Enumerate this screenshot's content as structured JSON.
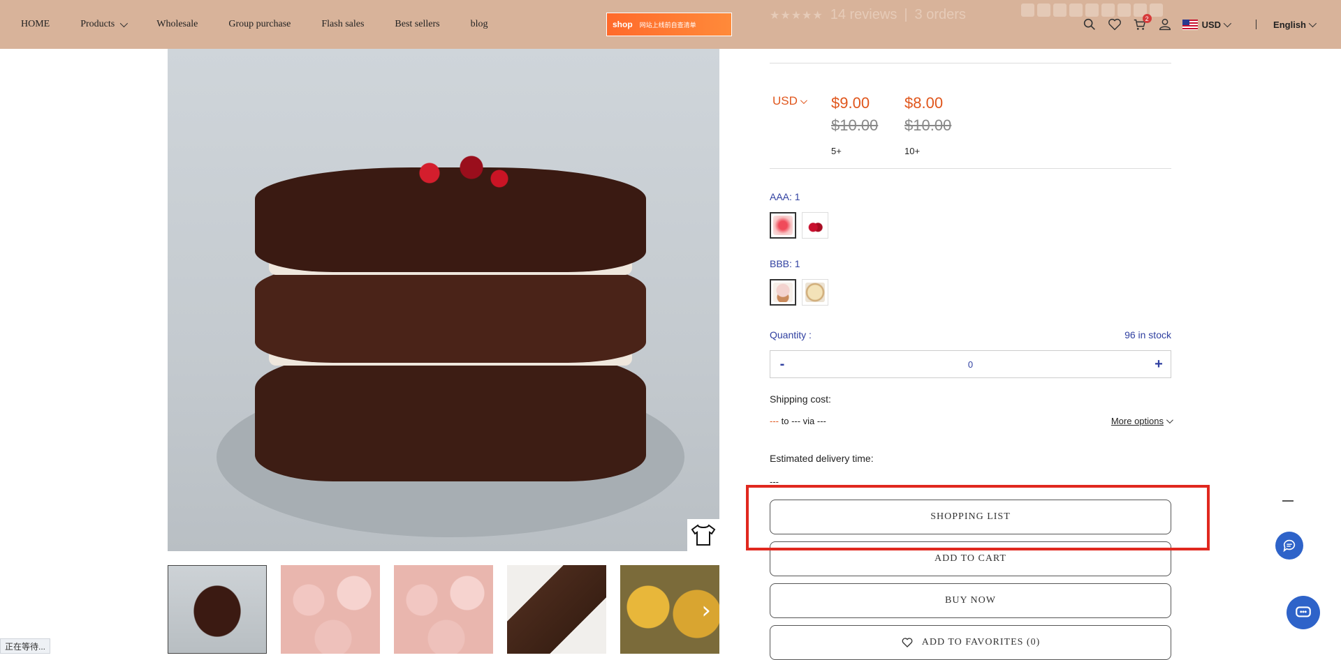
{
  "nav": {
    "items": [
      {
        "label": "HOME"
      },
      {
        "label": "Products"
      },
      {
        "label": "Wholesale"
      },
      {
        "label": "Group purchase"
      },
      {
        "label": "Flash sales"
      },
      {
        "label": "Best sellers"
      },
      {
        "label": "blog"
      }
    ],
    "logo_text": "shop",
    "logo_tagline": "网站上线前自查清单",
    "currency": "USD",
    "language": "English",
    "cart_count": "2"
  },
  "rating": {
    "stars": "★★★★★",
    "reviews": "14 reviews",
    "divider": "|",
    "orders": "3 orders"
  },
  "price": {
    "currency_selector": "USD",
    "tiers": [
      {
        "price": "$9.00",
        "original": "$10.00",
        "qty": "5+"
      },
      {
        "price": "$8.00",
        "original": "$10.00",
        "qty": "10+"
      }
    ]
  },
  "options": {
    "aaa_label": "AAA: 1",
    "bbb_label": "BBB: 1"
  },
  "quantity": {
    "label": "Quantity :",
    "stock": "96 in stock",
    "minus": "-",
    "value": "0",
    "plus": "+"
  },
  "shipping": {
    "title": "Shipping cost:",
    "from": "---",
    "route": " to --- via ---",
    "more": "More options"
  },
  "delivery": {
    "title": "Estimated delivery time:",
    "value": "---"
  },
  "actions": {
    "shopping_list": "SHOPPING LIST",
    "add_to_cart": "ADD TO CART",
    "buy_now": "BUY NOW",
    "add_to_favorites": "ADD TO FAVORITES (0)"
  },
  "gallery": {
    "next": "›"
  },
  "statusbar": {
    "text": "正在等待..."
  },
  "colors": {
    "accent": "#e0561c",
    "link_blue": "#2f3fa0",
    "highlight": "#e0281f",
    "chat": "#2e63c9"
  }
}
